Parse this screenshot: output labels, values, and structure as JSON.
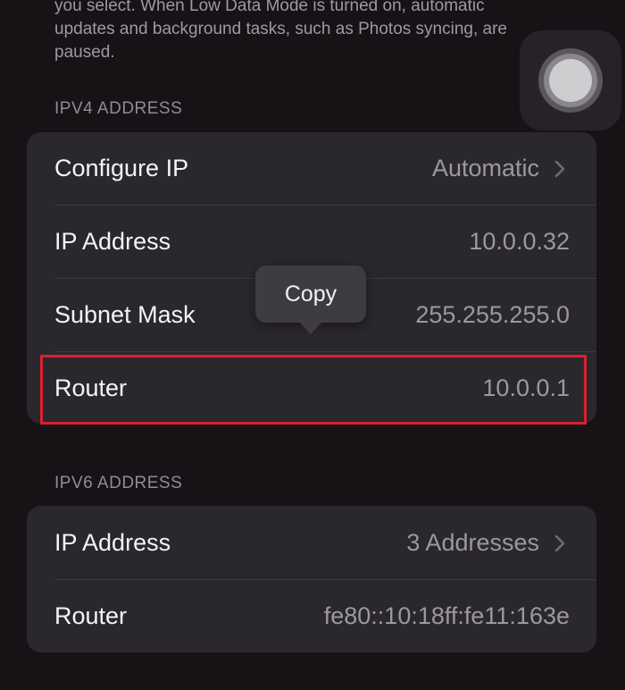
{
  "intro_text": "you select. When Low Data Mode is turned on, automatic updates and background tasks, such as Photos syncing, are paused.",
  "ipv4": {
    "header": "IPV4 ADDRESS",
    "rows": [
      {
        "label": "Configure IP",
        "value": "Automatic",
        "chevron": true
      },
      {
        "label": "IP Address",
        "value": "10.0.0.32",
        "chevron": false
      },
      {
        "label": "Subnet Mask",
        "value": "255.255.255.0",
        "chevron": false
      },
      {
        "label": "Router",
        "value": "10.0.0.1",
        "chevron": false
      }
    ]
  },
  "ipv6": {
    "header": "IPV6 ADDRESS",
    "rows": [
      {
        "label": "IP Address",
        "value": "3 Addresses",
        "chevron": true
      },
      {
        "label": "Router",
        "value": "fe80::10:18ff:fe11:163e",
        "chevron": false
      }
    ]
  },
  "popover": {
    "label": "Copy"
  },
  "icons": {
    "chevron": "chevron-right-icon",
    "assistive_touch": "assistive-touch-icon"
  },
  "colors": {
    "background": "#161216",
    "group_background": "#2b282d",
    "highlight_border": "#d92130",
    "secondary_text": "#9b989e"
  }
}
